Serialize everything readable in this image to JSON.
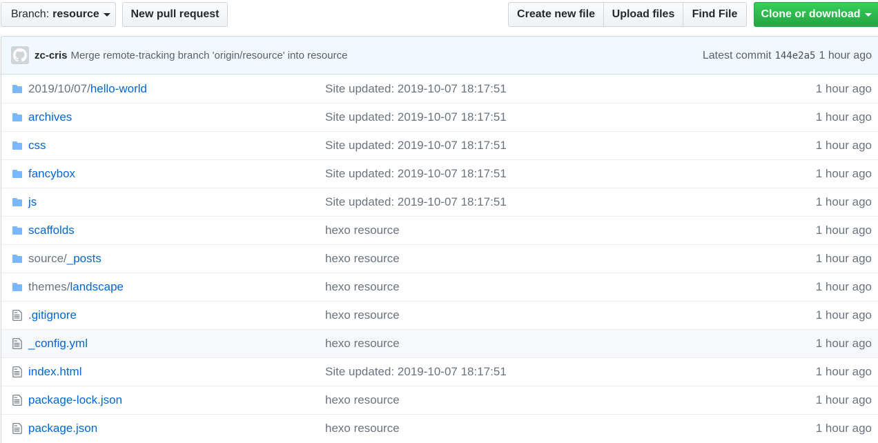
{
  "toolbar": {
    "branch_label": "Branch:",
    "branch_name": "resource",
    "new_pull_request": "New pull request",
    "create_new_file": "Create new file",
    "upload_files": "Upload files",
    "find_file": "Find File",
    "clone_or_download": "Clone or download",
    "clone_color": "#28a745"
  },
  "commit": {
    "avatar_icon": "github-octocat-icon",
    "author": "zc-cris",
    "message": "Merge remote-tracking branch 'origin/resource' into resource",
    "latest_label": "Latest commit",
    "sha": "144e2a5",
    "age": "1 hour ago"
  },
  "files": [
    {
      "type": "folder",
      "prefix": "2019/10/07/",
      "name": "hello-world",
      "message": "Site updated: 2019-10-07 18:17:51",
      "age": "1 hour ago"
    },
    {
      "type": "folder",
      "prefix": "",
      "name": "archives",
      "message": "Site updated: 2019-10-07 18:17:51",
      "age": "1 hour ago"
    },
    {
      "type": "folder",
      "prefix": "",
      "name": "css",
      "message": "Site updated: 2019-10-07 18:17:51",
      "age": "1 hour ago"
    },
    {
      "type": "folder",
      "prefix": "",
      "name": "fancybox",
      "message": "Site updated: 2019-10-07 18:17:51",
      "age": "1 hour ago"
    },
    {
      "type": "folder",
      "prefix": "",
      "name": "js",
      "message": "Site updated: 2019-10-07 18:17:51",
      "age": "1 hour ago"
    },
    {
      "type": "folder",
      "prefix": "",
      "name": "scaffolds",
      "message": "hexo resource",
      "age": "1 hour ago"
    },
    {
      "type": "folder",
      "prefix": "source/",
      "name": "_posts",
      "message": "hexo resource",
      "age": "1 hour ago"
    },
    {
      "type": "folder",
      "prefix": "themes/",
      "name": "landscape",
      "message": "hexo resource",
      "age": "1 hour ago"
    },
    {
      "type": "file",
      "prefix": "",
      "name": ".gitignore",
      "message": "hexo resource",
      "age": "1 hour ago"
    },
    {
      "type": "file",
      "prefix": "",
      "name": "_config.yml",
      "message": "hexo resource",
      "age": "1 hour ago",
      "highlighted": true
    },
    {
      "type": "file",
      "prefix": "",
      "name": "index.html",
      "message": "Site updated: 2019-10-07 18:17:51",
      "age": "1 hour ago"
    },
    {
      "type": "file",
      "prefix": "",
      "name": "package-lock.json",
      "message": "hexo resource",
      "age": "1 hour ago"
    },
    {
      "type": "file",
      "prefix": "",
      "name": "package.json",
      "message": "hexo resource",
      "age": "1 hour ago"
    }
  ],
  "colors": {
    "link": "#0366d6",
    "muted": "#6a737d",
    "folder_icon": "#79b8ff",
    "file_icon": "#6a737d",
    "commit_bar_bg": "#f1f8ff"
  }
}
